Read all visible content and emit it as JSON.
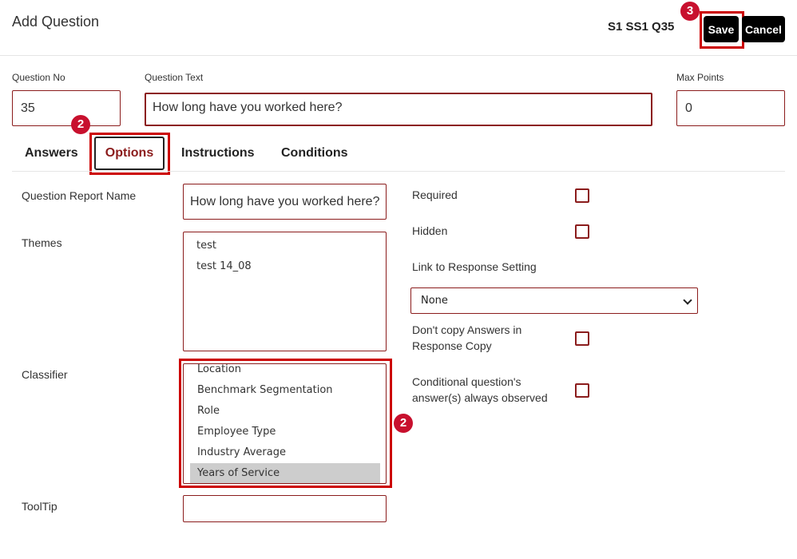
{
  "header": {
    "title": "Add Question",
    "reference": "S1 SS1 Q35",
    "save_label": "Save",
    "cancel_label": "Cancel"
  },
  "annotations": {
    "options_badge": "2",
    "classifier_badge": "2",
    "save_badge": "3"
  },
  "question": {
    "number_label": "Question No",
    "number_value": "35",
    "text_label": "Question Text",
    "text_value": "How long have you worked here?",
    "max_points_label": "Max Points",
    "max_points_value": "0"
  },
  "tabs": [
    {
      "label": "Answers"
    },
    {
      "label": "Options",
      "active": true
    },
    {
      "label": "Instructions"
    },
    {
      "label": "Conditions"
    }
  ],
  "options": {
    "report_name_label": "Question Report Name",
    "report_name_value": "How long have you worked here?",
    "themes_label": "Themes",
    "themes": [
      "test",
      "test 14_08"
    ],
    "classifier_label": "Classifier",
    "classifier_items": [
      "Location",
      "Benchmark Segmentation",
      "Role",
      "Employee Type",
      "Industry Average",
      "Years of Service"
    ],
    "classifier_selected": "Years of Service",
    "tooltip_label": "ToolTip",
    "tooltip_value": "",
    "required_label": "Required",
    "required_checked": false,
    "hidden_label": "Hidden",
    "hidden_checked": false,
    "link_label": "Link to Response Setting",
    "link_value": "None",
    "dont_copy_label_1": "Don't copy Answers in",
    "dont_copy_label_2": "Response Copy",
    "dont_copy_checked": false,
    "conditional_label_1": "Conditional question's",
    "conditional_label_2": "answer(s) always observed",
    "conditional_checked": false
  },
  "colors": {
    "accent": "#8b1c1c",
    "highlight": "#cc0000",
    "badge": "#c8102e"
  }
}
